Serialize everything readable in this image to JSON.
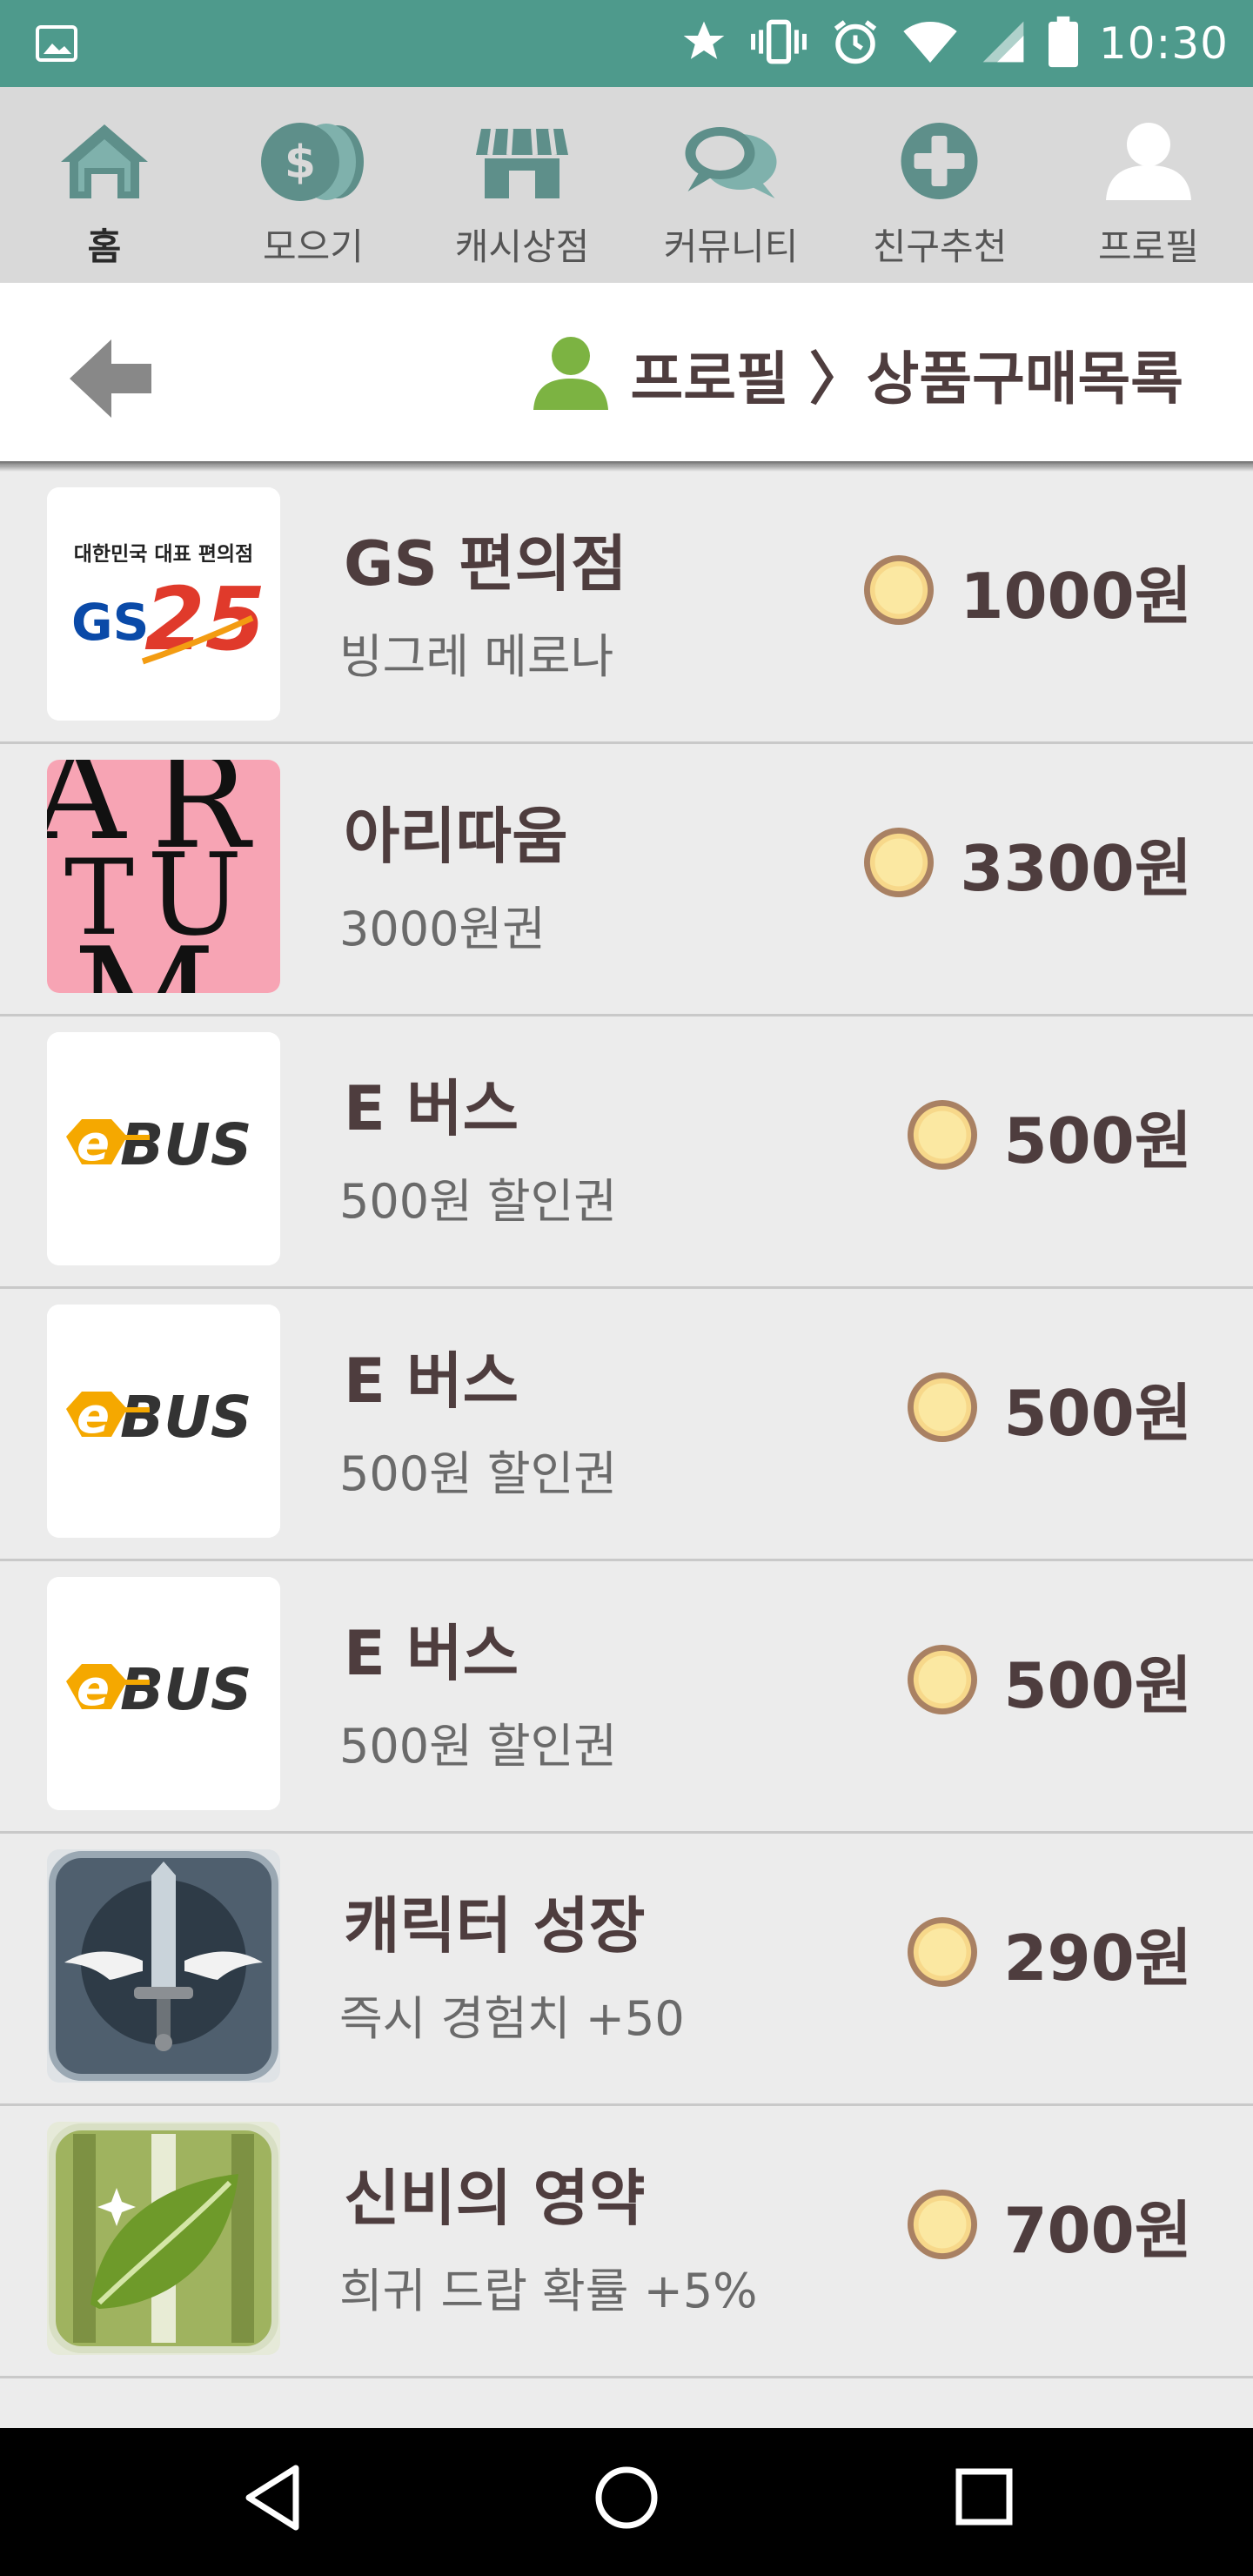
{
  "status_bar": {
    "time": "10:30",
    "icons": [
      "image-icon",
      "star-icon",
      "vibrate-icon",
      "alarm-icon",
      "wifi-icon",
      "signal-icon",
      "battery-icon"
    ],
    "background_color": "#4e9a8c"
  },
  "top_nav": {
    "items": [
      {
        "label": "홈",
        "icon": "home-icon",
        "active": true
      },
      {
        "label": "모으기",
        "icon": "coins-icon",
        "active": false
      },
      {
        "label": "캐시상점",
        "icon": "store-icon",
        "active": false
      },
      {
        "label": "커뮤니티",
        "icon": "chat-icon",
        "active": false
      },
      {
        "label": "친구추천",
        "icon": "plus-icon",
        "active": false
      },
      {
        "label": "프로필",
        "icon": "person-icon",
        "active": false
      }
    ],
    "icon_color": "#5e8f8a"
  },
  "header": {
    "breadcrumb": "프로필 〉상품구매목록",
    "back_icon": "back-arrow-icon",
    "profile_icon_color": "#7cb342"
  },
  "purchases": [
    {
      "title": "GS 편의점",
      "subtitle": "빙그레 메로나",
      "price": "1000원",
      "thumb": "gs25-logo",
      "thumb_caption": "대한민국 대표 편의점",
      "thumb_brand": "GS25"
    },
    {
      "title": "아리따움",
      "subtitle": "3000원권",
      "price": "3300원",
      "thumb": "aritaum-logo",
      "thumb_brand": "ARITAUM"
    },
    {
      "title": "E 버스",
      "subtitle": "500원 할인권",
      "price": "500원",
      "thumb": "ebus-logo",
      "thumb_brand": "eBUS"
    },
    {
      "title": "E 버스",
      "subtitle": "500원 할인권",
      "price": "500원",
      "thumb": "ebus-logo",
      "thumb_brand": "eBUS"
    },
    {
      "title": "E 버스",
      "subtitle": "500원 할인권",
      "price": "500원",
      "thumb": "ebus-logo",
      "thumb_brand": "eBUS"
    },
    {
      "title": "캐릭터 성장",
      "subtitle": "즉시 경험치 +50",
      "price": "290원",
      "thumb": "winged-sword-icon"
    },
    {
      "title": "신비의 영약",
      "subtitle": "희귀 드랍 확률 +5%",
      "price": "700원",
      "thumb": "leaf-icon"
    }
  ],
  "nav_bar": {
    "icons": [
      "back-triangle-icon",
      "home-circle-icon",
      "recents-square-icon"
    ]
  }
}
